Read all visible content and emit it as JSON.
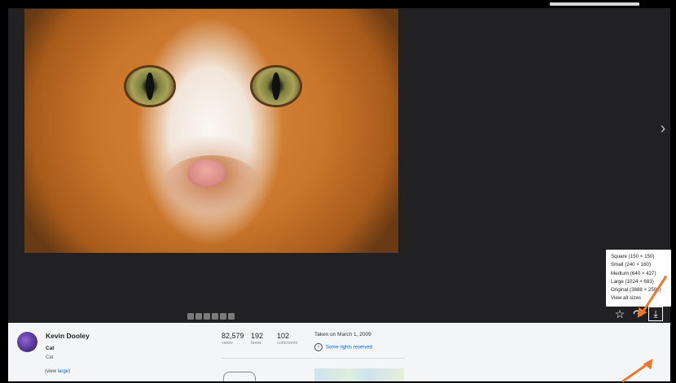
{
  "photo": {
    "alt": "Cat"
  },
  "navigation": {
    "next_glyph": "›"
  },
  "size_menu": {
    "options": [
      "Square (150 × 150)",
      "Small (240 × 160)",
      "Medium (640 × 427)",
      "Large (1024 × 683)",
      "Original (3888 × 2592)",
      "View all sizes"
    ]
  },
  "actions": {
    "favorite_glyph": "☆",
    "share_glyph": "↷",
    "download_glyph": "⤓"
  },
  "info": {
    "author": "Kevin Dooley",
    "title": "Cat",
    "description": "Cat",
    "view_prefix": "(view ",
    "view_link": "large",
    "view_suffix": ")",
    "stats": {
      "views": "82,579",
      "views_label": "views",
      "faves": "192",
      "faves_label": "faves",
      "comments": "102",
      "comments_label": "comments"
    },
    "taken": "Taken on March 1, 2009",
    "rights": "Some rights reserved"
  },
  "colors": {
    "viewer_bg": "#212124",
    "info_bg": "#f3f5f6",
    "link": "#0063dc",
    "annotation_arrow": "#e8792e"
  }
}
